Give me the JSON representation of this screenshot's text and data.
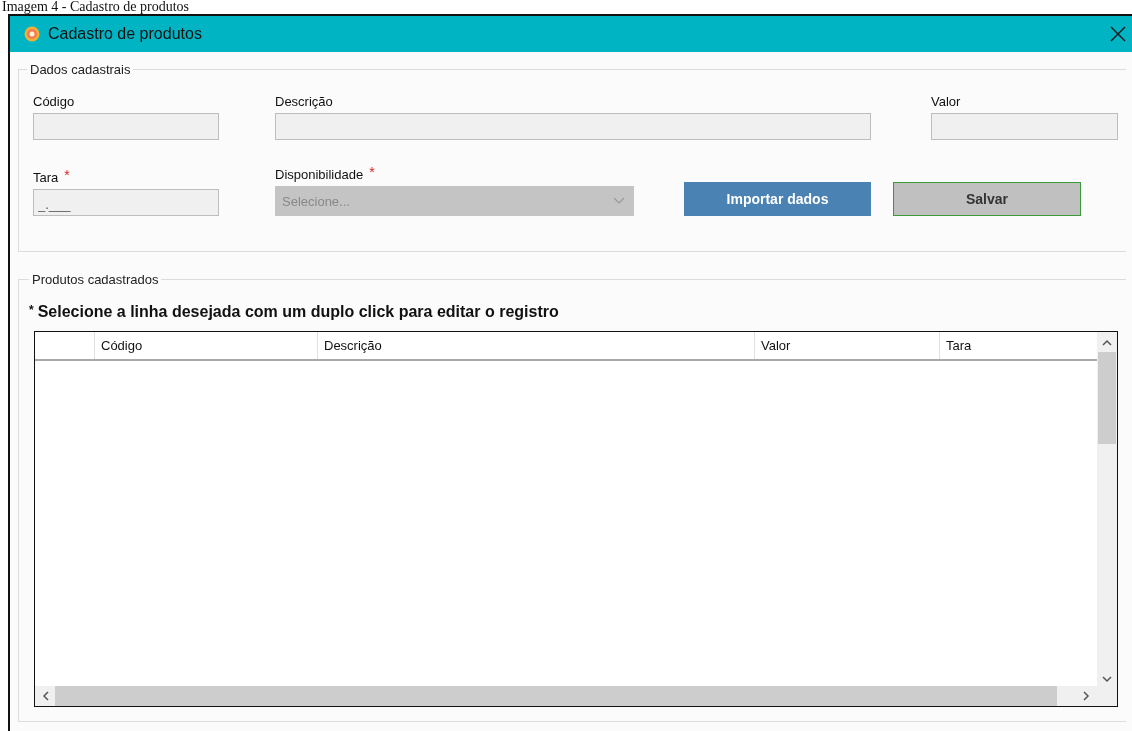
{
  "caption": "Imagem 4 - Cadastro de produtos",
  "window": {
    "title": "Cadastro de produtos"
  },
  "form": {
    "legend": "Dados cadastrais",
    "row_1": [
      {
        "kind": "text",
        "label": "Código",
        "disabled": true
      },
      {
        "kind": "text",
        "label": "Descrição",
        "disabled": true
      },
      {
        "kind": "text",
        "label": "Valor",
        "disabled": true
      }
    ],
    "row_2": [
      {
        "kind": "text",
        "label": "Tara",
        "required_mark": "*",
        "value": "_.___",
        "disabled": true
      },
      {
        "kind": "select",
        "label": "Disponibilidade",
        "required_mark": "*",
        "placeholder": "Selecione...",
        "disabled": true
      },
      {
        "kind": "primary",
        "label": "Importar dados"
      },
      {
        "kind": "secondary",
        "label": "Salvar"
      }
    ]
  },
  "list": {
    "legend": "Produtos cadastrados",
    "hint_mark": "*",
    "hint": "Selecione a linha desejada com um duplo click para editar o registro",
    "table": {
      "columns": [
        "Código",
        "Descrição",
        "Valor",
        "Tara"
      ]
    }
  }
}
